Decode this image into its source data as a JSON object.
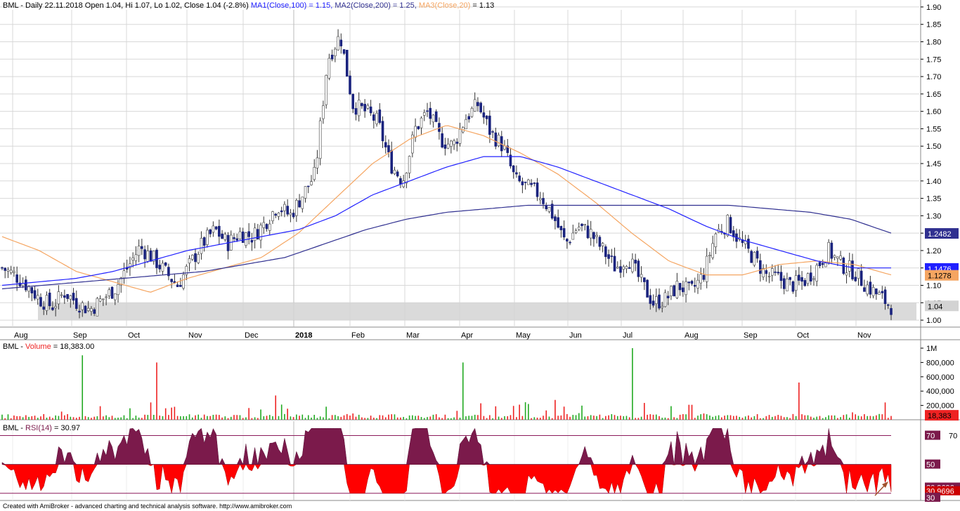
{
  "colors": {
    "background": "#ffffff",
    "candle_up": "#ffffff",
    "candle_down": "#1a237e",
    "candle_wick": "#333333",
    "ma1": "#2020ff",
    "ma2": "#303090",
    "ma3": "#f5a561",
    "volume_up": "#22aa22",
    "volume_down": "#ee2222",
    "rsi_fill_up": "#7b1a4b",
    "rsi_fill_down": "#ff0000",
    "grid": "#d8d8d8",
    "axis_bg": "#ffffff",
    "rsi_band": "#8b1a5a",
    "support_box": "#d3d3d3"
  },
  "header": {
    "price_prefix": "BML - Daily 22.11.2018 Open 1.04, Hi 1.07, Lo 1.02, Close 1.04 (-2.8%)",
    "ma1_label": "MA1(Close,100) = 1.15,",
    "ma2_label": "MA2(Close,200) = 1.25,",
    "ma3_label": "MA3(Close,20)",
    "ma3_value": "= 1.13",
    "volume_prefix": "BML -",
    "volume_label": "Volume",
    "volume_value": "= 18,383.00",
    "rsi_prefix": "BML -",
    "rsi_label": "RSI(14)",
    "rsi_value": "= 30.97",
    "footer": "Created with AmiBroker - advanced charting and technical analysis software. http://www.amibroker.com"
  },
  "chart_data": [
    {
      "type": "candlestick",
      "title": "BML - Daily 22.11.2018",
      "ohlc_last": {
        "open": 1.04,
        "high": 1.07,
        "low": 1.02,
        "close": 1.04,
        "change_pct": -2.8
      },
      "x_labels": [
        "Aug",
        "Sep",
        "Oct",
        "Nov",
        "Dec",
        "2018",
        "Feb",
        "Mar",
        "Apr",
        "May",
        "Jun",
        "Jul",
        "Aug",
        "Sep",
        "Oct",
        "Nov"
      ],
      "y_ticks": [
        1.0,
        1.05,
        1.1,
        1.15,
        1.2,
        1.25,
        1.3,
        1.35,
        1.4,
        1.45,
        1.5,
        1.55,
        1.6,
        1.65,
        1.7,
        1.75,
        1.8,
        1.85,
        1.9
      ],
      "ylim": [
        0.98,
        1.92
      ],
      "close_path": [
        1.15,
        1.13,
        1.1,
        1.06,
        1.04,
        1.08,
        1.05,
        1.03,
        1.06,
        1.09,
        1.15,
        1.21,
        1.18,
        1.14,
        1.1,
        1.16,
        1.22,
        1.26,
        1.22,
        1.25,
        1.24,
        1.28,
        1.33,
        1.3,
        1.36,
        1.42,
        1.75,
        1.82,
        1.62,
        1.6,
        1.57,
        1.45,
        1.4,
        1.55,
        1.6,
        1.52,
        1.5,
        1.58,
        1.62,
        1.54,
        1.5,
        1.4,
        1.38,
        1.36,
        1.3,
        1.22,
        1.27,
        1.25,
        1.2,
        1.15,
        1.18,
        1.11,
        1.05,
        1.06,
        1.1,
        1.08,
        1.13,
        1.25,
        1.28,
        1.22,
        1.18,
        1.13,
        1.12,
        1.1,
        1.11,
        1.15,
        1.2,
        1.16,
        1.14,
        1.1,
        1.07,
        1.04
      ],
      "ma1_path": [
        1.1,
        1.11,
        1.12,
        1.14,
        1.17,
        1.2,
        1.22,
        1.24,
        1.26,
        1.3,
        1.36,
        1.4,
        1.44,
        1.47,
        1.47,
        1.44,
        1.4,
        1.36,
        1.32,
        1.27,
        1.23,
        1.2,
        1.17,
        1.15,
        1.15
      ],
      "ma2_path": [
        1.09,
        1.1,
        1.11,
        1.12,
        1.13,
        1.14,
        1.16,
        1.18,
        1.22,
        1.26,
        1.29,
        1.31,
        1.32,
        1.33,
        1.33,
        1.33,
        1.33,
        1.33,
        1.33,
        1.32,
        1.31,
        1.29,
        1.25
      ],
      "ma3_path": [
        1.24,
        1.2,
        1.14,
        1.11,
        1.08,
        1.12,
        1.15,
        1.18,
        1.25,
        1.35,
        1.45,
        1.52,
        1.56,
        1.53,
        1.48,
        1.42,
        1.34,
        1.25,
        1.17,
        1.13,
        1.13,
        1.16,
        1.17,
        1.16,
        1.13
      ],
      "support_zone": [
        1.0,
        1.05
      ],
      "right_labels": [
        {
          "text": "1.2482",
          "value": 1.2482,
          "bg": "#303090",
          "fg": "#ffffff"
        },
        {
          "text": "1.1476",
          "value": 1.1476,
          "bg": "#2020ff",
          "fg": "#ffffff"
        },
        {
          "text": "1.1278",
          "value": 1.1278,
          "bg": "#f5a561",
          "fg": "#000000"
        },
        {
          "text": "1.04",
          "value": 1.04,
          "bg": "#d3d3d3",
          "fg": "#000000"
        }
      ]
    },
    {
      "type": "bar",
      "title": "Volume",
      "value": 18383.0,
      "y_ticks": [
        "1M",
        "800,000",
        "600,000",
        "400,000",
        "200,000"
      ],
      "ylim": [
        0,
        1000000
      ],
      "last_label": "18,383"
    },
    {
      "type": "area",
      "title": "RSI(14)",
      "value": 30.97,
      "levels": [
        70,
        30
      ],
      "y_ticks": [
        "70",
        "50",
        "30"
      ],
      "ylim": [
        25,
        80
      ],
      "right_labels": [
        "70",
        "50",
        "30.9696",
        "30.9696",
        "30"
      ]
    }
  ]
}
